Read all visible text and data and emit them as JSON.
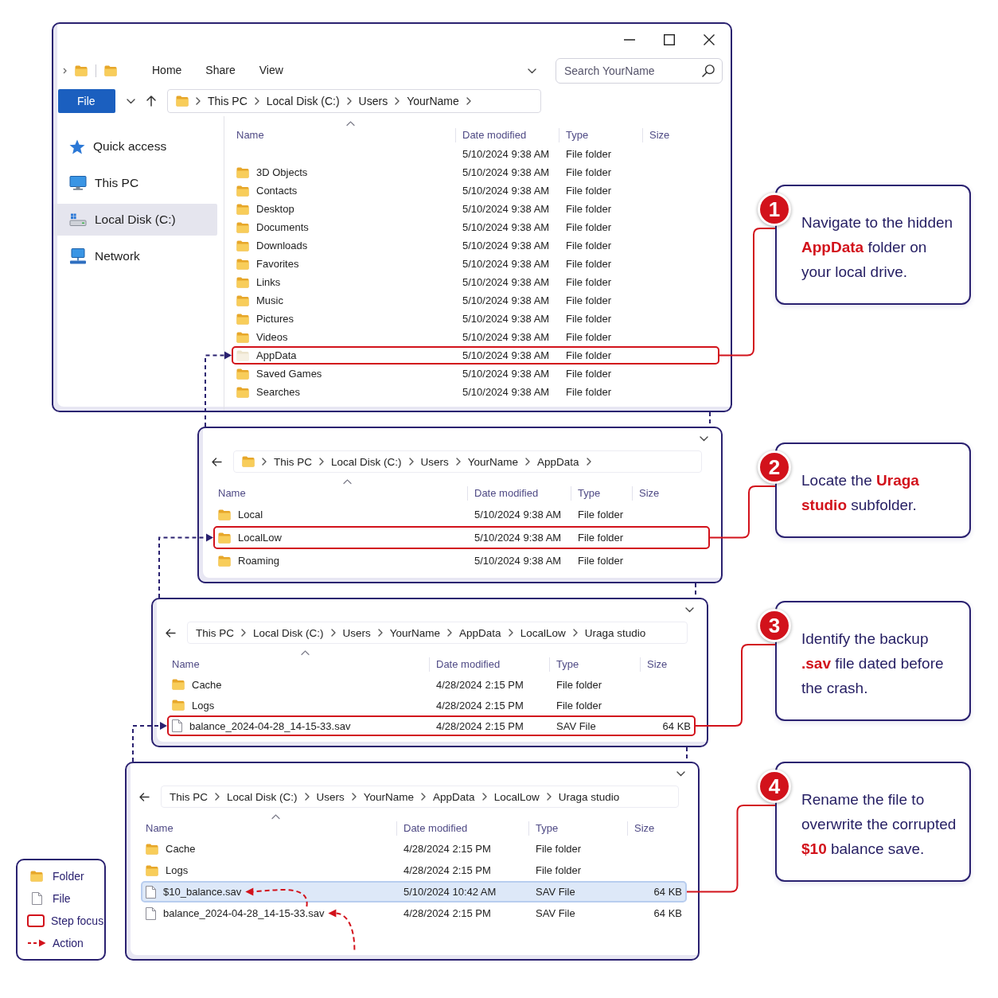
{
  "steps": [
    {
      "window": {
        "kind": "full",
        "ribbon_tabs": [
          {
            "label": "Home",
            "selected": false
          },
          {
            "label": "Share",
            "selected": false
          },
          {
            "label": "View",
            "selected": false
          }
        ],
        "search": {
          "placeholder": "Search YourName"
        },
        "file_tab": "File",
        "address": {
          "folder_icon": true,
          "trailing_chevron": true,
          "parts": [
            "This PC",
            "Local Disk (C:)",
            "Users",
            "YourName"
          ]
        },
        "sidebar": [
          {
            "kind": "star",
            "label": "Quick access",
            "selected": false
          },
          {
            "kind": "pc",
            "label": "This PC",
            "selected": false
          },
          {
            "kind": "drive",
            "label": "Local Disk (C:)",
            "selected": true
          },
          {
            "kind": "network",
            "label": "Network",
            "selected": false
          }
        ],
        "columns": [
          "Name",
          "Date modified",
          "Type",
          "Size"
        ],
        "rows": [
          {
            "date": "5/10/2024 9:38 AM",
            "type": "File folder",
            "selected": false,
            "focused": false
          },
          {
            "kind": "folder",
            "name": "3D Objects",
            "date": "5/10/2024 9:38 AM",
            "type": "File folder",
            "hidden": false,
            "selected": false,
            "focused": false
          },
          {
            "kind": "folder",
            "name": "Contacts",
            "date": "5/10/2024 9:38 AM",
            "type": "File folder",
            "hidden": false,
            "selected": false,
            "focused": false
          },
          {
            "kind": "folder",
            "name": "Desktop",
            "date": "5/10/2024 9:38 AM",
            "type": "File folder",
            "hidden": false,
            "selected": false,
            "focused": false
          },
          {
            "kind": "folder",
            "name": "Documents",
            "date": "5/10/2024 9:38 AM",
            "type": "File folder",
            "hidden": false,
            "selected": false,
            "focused": false
          },
          {
            "kind": "folder",
            "name": "Downloads",
            "date": "5/10/2024 9:38 AM",
            "type": "File folder",
            "hidden": false,
            "selected": false,
            "focused": false
          },
          {
            "kind": "folder",
            "name": "Favorites",
            "date": "5/10/2024 9:38 AM",
            "type": "File folder",
            "hidden": false,
            "selected": false,
            "focused": false
          },
          {
            "kind": "folder",
            "name": "Links",
            "date": "5/10/2024 9:38 AM",
            "type": "File folder",
            "hidden": false,
            "selected": false,
            "focused": false
          },
          {
            "kind": "folder",
            "name": "Music",
            "date": "5/10/2024 9:38 AM",
            "type": "File folder",
            "hidden": false,
            "selected": false,
            "focused": false
          },
          {
            "kind": "folder",
            "name": "Pictures",
            "date": "5/10/2024 9:38 AM",
            "type": "File folder",
            "hidden": false,
            "selected": false,
            "focused": false
          },
          {
            "kind": "folder",
            "name": "Videos",
            "date": "5/10/2024 9:38 AM",
            "type": "File folder",
            "hidden": false,
            "selected": false,
            "focused": false
          },
          {
            "kind": "folder",
            "name": "AppData",
            "date": "5/10/2024 9:38 AM",
            "type": "File folder",
            "hidden": true,
            "selected": false,
            "focused": true
          },
          {
            "kind": "folder",
            "name": "Saved Games",
            "date": "5/10/2024 9:38 AM",
            "type": "File folder",
            "hidden": false,
            "selected": false,
            "focused": false
          },
          {
            "kind": "folder",
            "name": "Searches",
            "date": "5/10/2024 9:38 AM",
            "type": "File folder",
            "hidden": false,
            "selected": false,
            "focused": false
          }
        ]
      },
      "callout": {
        "number": "1",
        "text": "Navigate to the hidden **AppData** folder on your local drive."
      }
    },
    {
      "window": {
        "kind": "compact",
        "address": {
          "folder_icon": true,
          "trailing_chevron": true,
          "parts": [
            "This PC",
            "Local Disk (C:)",
            "Users",
            "YourName",
            "AppData"
          ]
        },
        "columns": [
          "Name",
          "Date modified",
          "Type",
          "Size"
        ],
        "rows": [
          {
            "kind": "folder",
            "name": "Local",
            "date": "5/10/2024 9:38 AM",
            "type": "File folder",
            "selected": false,
            "focused": false
          },
          {
            "kind": "folder",
            "name": "LocalLow",
            "date": "5/10/2024 9:38 AM",
            "type": "File folder",
            "selected": false,
            "focused": true
          },
          {
            "kind": "folder",
            "name": "Roaming",
            "date": "5/10/2024 9:38 AM",
            "type": "File folder",
            "selected": false,
            "focused": false
          }
        ]
      },
      "callout": {
        "number": "2",
        "text": "Locate the **Uraga studio** subfolder."
      }
    },
    {
      "window": {
        "kind": "compact",
        "address": {
          "folder_icon": false,
          "trailing_chevron": false,
          "parts": [
            "This PC",
            "Local Disk (C:)",
            "Users",
            "YourName",
            "AppData",
            "LocalLow",
            "Uraga studio"
          ]
        },
        "columns": [
          "Name",
          "Date modified",
          "Type",
          "Size"
        ],
        "rows": [
          {
            "kind": "folder",
            "name": "Cache",
            "date": "4/28/2024 2:15 PM",
            "type": "File folder",
            "selected": false,
            "focused": false
          },
          {
            "kind": "folder",
            "name": "Logs",
            "date": "4/28/2024 2:15 PM",
            "type": "File folder",
            "selected": false,
            "focused": false
          },
          {
            "kind": "file",
            "name": "balance_2024-04-28_14-15-33.sav",
            "date": "4/28/2024 2:15 PM",
            "type": "SAV File",
            "size": "64 KB",
            "selected": false,
            "focused": true
          }
        ]
      },
      "callout": {
        "number": "3",
        "text": "Identify the backup **.sav** file dated before the crash."
      }
    },
    {
      "window": {
        "kind": "compact",
        "address": {
          "folder_icon": false,
          "trailing_chevron": false,
          "parts": [
            "This PC",
            "Local Disk (C:)",
            "Users",
            "YourName",
            "AppData",
            "LocalLow",
            "Uraga studio"
          ]
        },
        "columns": [
          "Name",
          "Date modified",
          "Type",
          "Size"
        ],
        "rows": [
          {
            "kind": "folder",
            "name": "Cache",
            "date": "4/28/2024 2:15 PM",
            "type": "File folder",
            "selected": false,
            "focused": false,
            "action": false
          },
          {
            "kind": "folder",
            "name": "Logs",
            "date": "4/28/2024 2:15 PM",
            "type": "File folder",
            "selected": false,
            "focused": false,
            "action": false
          },
          {
            "kind": "file",
            "name": "$10_balance.sav",
            "date": "5/10/2024 10:42 AM",
            "type": "SAV File",
            "size": "64 KB",
            "selected": true,
            "focused": false,
            "action": true
          },
          {
            "kind": "file",
            "name": "balance_2024-04-28_14-15-33.sav",
            "date": "4/28/2024 2:15 PM",
            "type": "SAV File",
            "size": "64 KB",
            "selected": false,
            "focused": false,
            "action": true
          }
        ]
      },
      "callout": {
        "number": "4",
        "text": "Rename the file to overwrite the corrupted **$10** balance save."
      }
    }
  ],
  "legend": [
    {
      "kind": "folder",
      "label": "Folder"
    },
    {
      "kind": "file",
      "label": "File"
    },
    {
      "kind": "focus",
      "label": "Step focus"
    },
    {
      "kind": "action",
      "label": "Action"
    }
  ]
}
